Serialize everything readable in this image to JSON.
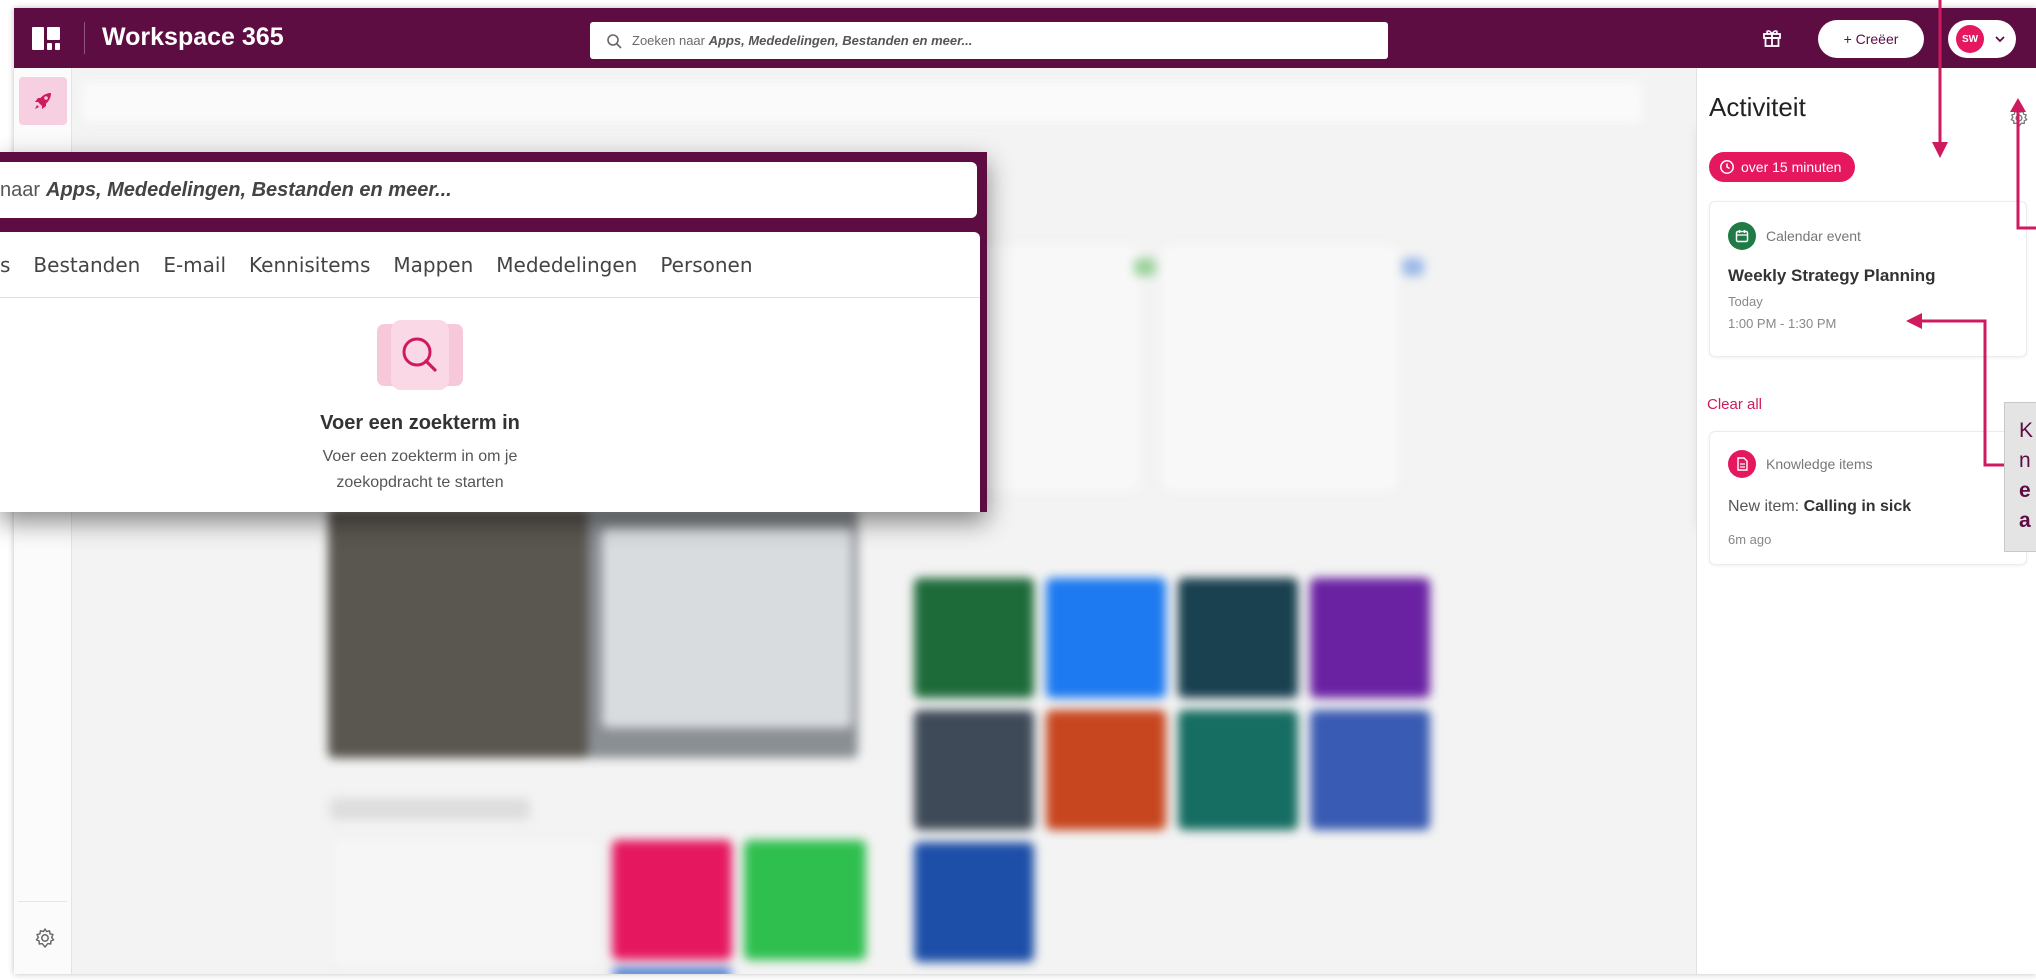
{
  "app": {
    "title": "Workspace 365"
  },
  "search": {
    "prefix": "Zoeken naar",
    "emphasis": "Apps, Mededelingen, Bestanden en meer..."
  },
  "header": {
    "create_label": "+ Creëer",
    "avatar_initials": "SW"
  },
  "search_popup": {
    "input_prefix": "naar",
    "input_emphasis": "Apps, Mededelingen, Bestanden en meer...",
    "tabs": [
      "s",
      "Bestanden",
      "E-mail",
      "Kennisitems",
      "Mappen",
      "Mededelingen",
      "Personen"
    ],
    "empty_title": "Voer een zoekterm in",
    "empty_desc_line1": "Voer een zoekterm in om je",
    "empty_desc_line2": "zoekopdracht te starten"
  },
  "activity": {
    "title": "Activiteit",
    "time_pill": "over 15 minuten",
    "event": {
      "type_label": "Calendar event",
      "title": "Weekly Strategy Planning",
      "day": "Today",
      "time": "1:00 PM - 1:30 PM"
    },
    "clear_all": "Clear all",
    "knowledge": {
      "type_label": "Knowledge items",
      "prefix": "New item: ",
      "item": "Calling in sick",
      "age": "6m ago"
    }
  },
  "callout": {
    "lines": [
      "K",
      "n",
      "e",
      "a"
    ]
  },
  "colors": {
    "brand": "#5e0d43",
    "accent": "#e5175f",
    "event_green": "#1f7a46"
  }
}
